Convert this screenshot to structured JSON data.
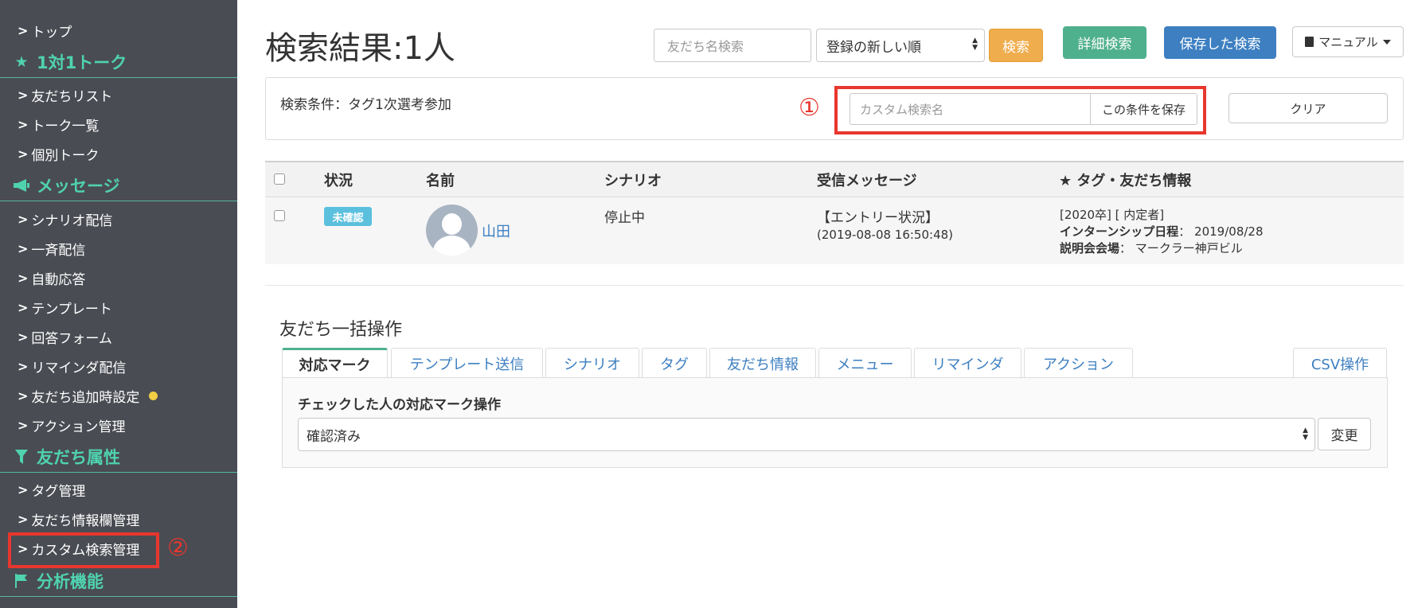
{
  "sidebar": {
    "items_top": [
      {
        "label": "トップ"
      }
    ],
    "sections": [
      {
        "title": "1対1トーク",
        "icon": "star-icon",
        "items": [
          "友だちリスト",
          "トーク一覧",
          "個別トーク"
        ]
      },
      {
        "title": "メッセージ",
        "icon": "megaphone-icon",
        "items": [
          "シナリオ配信",
          "一斉配信",
          "自動応答",
          "テンプレート",
          "回答フォーム",
          "リマインダ配信",
          "友だち追加時設定",
          "アクション管理"
        ]
      },
      {
        "title": "友だち属性",
        "icon": "filter-icon",
        "items": [
          "タグ管理",
          "友だち情報欄管理",
          "カスタム検索管理"
        ]
      },
      {
        "title": "分析機能",
        "icon": "flag-icon",
        "items": []
      }
    ],
    "annotation_2": "②"
  },
  "header": {
    "title": "検索結果:1人",
    "search_placeholder": "友だち名検索",
    "sort_value": "登録の新しい順",
    "search_button": "検索",
    "detail_search_button": "詳細検索",
    "saved_search_button": "保存した検索",
    "manual_button": "マニュアル"
  },
  "condition": {
    "label": "検索条件：タグ1次選考参加",
    "custom_name_placeholder": "カスタム検索名",
    "save_button": "この条件を保存",
    "clear_button": "クリア",
    "annotation_1": "①"
  },
  "table": {
    "headers": [
      "状況",
      "名前",
      "シナリオ",
      "受信メッセージ",
      "★ タグ・友だち情報"
    ],
    "rows": [
      {
        "status": "未確認",
        "name": "山田",
        "scenario": "停止中",
        "message": "【エントリー状況】",
        "message_time": "(2019-08-08 16:50:48)",
        "tags": "[2020卒] [ 内定者]",
        "info1_label": "インターンシップ日程",
        "info1_value": "2019/08/28",
        "info2_label": "説明会会場",
        "info2_value": "マークラー神戸ビル"
      }
    ]
  },
  "bulk": {
    "title": "友だち一括操作",
    "tabs": [
      "対応マーク",
      "テンプレート送信",
      "シナリオ",
      "タグ",
      "友だち情報",
      "メニュー",
      "リマインダ",
      "アクション",
      "CSV操作"
    ],
    "active_tab": "対応マーク",
    "op_label": "チェックした人の対応マーク操作",
    "op_value": "確認済み",
    "change_button": "変更"
  },
  "colors": {
    "sidebar_bg": "#4a4c53",
    "sidebar_heading": "#4fd2b0",
    "accent_red": "#e8372e",
    "search_orange": "#f0ad4e",
    "detail_green": "#4fb08d",
    "saved_blue": "#3d7fc1",
    "badge_blue": "#5bc0de"
  }
}
